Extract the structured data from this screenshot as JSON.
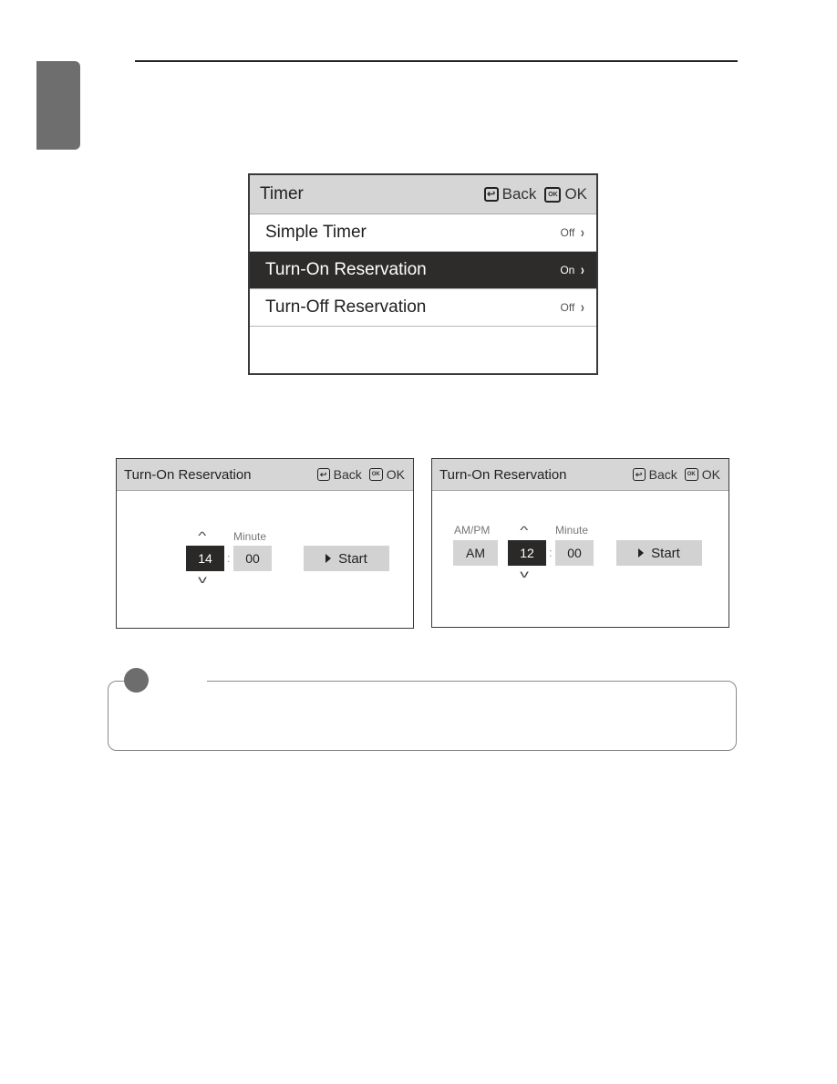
{
  "page": {
    "side_tab_color": "#6f6e6e"
  },
  "timer_screen": {
    "title": "Timer",
    "back_label": "Back",
    "ok_label": "OK",
    "back_icon": "return-arrow-icon",
    "ok_icon": "ok-key-icon",
    "items": [
      {
        "label": "Simple Timer",
        "value": "Off",
        "selected": false
      },
      {
        "label": "Turn-On Reservation",
        "value": "On",
        "selected": true
      },
      {
        "label": "Turn-Off Reservation",
        "value": "Off",
        "selected": false
      }
    ]
  },
  "reservation_24h": {
    "title": "Turn-On Reservation",
    "back_label": "Back",
    "ok_label": "OK",
    "minute_label": "Minute",
    "hour_value": "14",
    "minute_value": "00",
    "separator": ":",
    "start_label": "Start"
  },
  "reservation_12h": {
    "title": "Turn-On Reservation",
    "back_label": "Back",
    "ok_label": "OK",
    "ampm_label": "AM/PM",
    "ampm_value": "AM",
    "minute_label": "Minute",
    "hour_value": "12",
    "minute_value": "00",
    "separator": ":",
    "start_label": "Start"
  },
  "icons": {
    "back_glyph": "↩",
    "ok_glyph": "OK",
    "chevron_right": "›",
    "arrow_up": "^",
    "arrow_down": "v"
  }
}
